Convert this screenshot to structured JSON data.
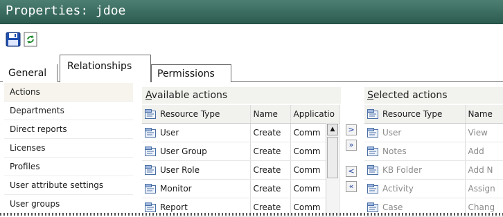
{
  "window": {
    "title": "Properties: jdoe"
  },
  "toolbar": {
    "save_icon": "floppy-disk",
    "refresh_icon": "refresh-arrows"
  },
  "tabs": [
    {
      "label": "General",
      "active": false
    },
    {
      "label": "Relationships",
      "active": true
    },
    {
      "label": "Permissions",
      "active": false
    }
  ],
  "sidebar": {
    "items": [
      {
        "label": "Actions",
        "active": true
      },
      {
        "label": "Departments"
      },
      {
        "label": "Direct reports"
      },
      {
        "label": "Licenses"
      },
      {
        "label": "Profiles"
      },
      {
        "label": "User attribute settings"
      },
      {
        "label": "User groups"
      }
    ]
  },
  "available": {
    "title_underlined": "A",
    "title_rest": "vailable actions",
    "columns": [
      "Resource Type",
      "Name",
      "Applicatio"
    ],
    "rows": [
      [
        "User",
        "Create",
        "Comm"
      ],
      [
        "User Group",
        "Create",
        "Comm"
      ],
      [
        "User Role",
        "Create",
        "Comm"
      ],
      [
        "Monitor",
        "Create",
        "Comm"
      ],
      [
        "Report",
        "Create",
        "Comm"
      ]
    ]
  },
  "selected": {
    "title_underlined": "S",
    "title_rest": "elected actions",
    "columns": [
      "Resource Type",
      "Name"
    ],
    "rows": [
      [
        "User",
        "View"
      ],
      [
        "Notes",
        "Add"
      ],
      [
        "KB Folder",
        "Add N"
      ],
      [
        "Activity",
        "Assign"
      ],
      [
        "Case",
        "Chang"
      ]
    ]
  },
  "move_buttons": {
    "add": ">",
    "add_all": "»",
    "remove": "<",
    "remove_all": "«"
  },
  "colors": {
    "title_bar": "#3e6f63",
    "title_text": "#ffffff",
    "move_arrow": "#1d3f9e"
  }
}
